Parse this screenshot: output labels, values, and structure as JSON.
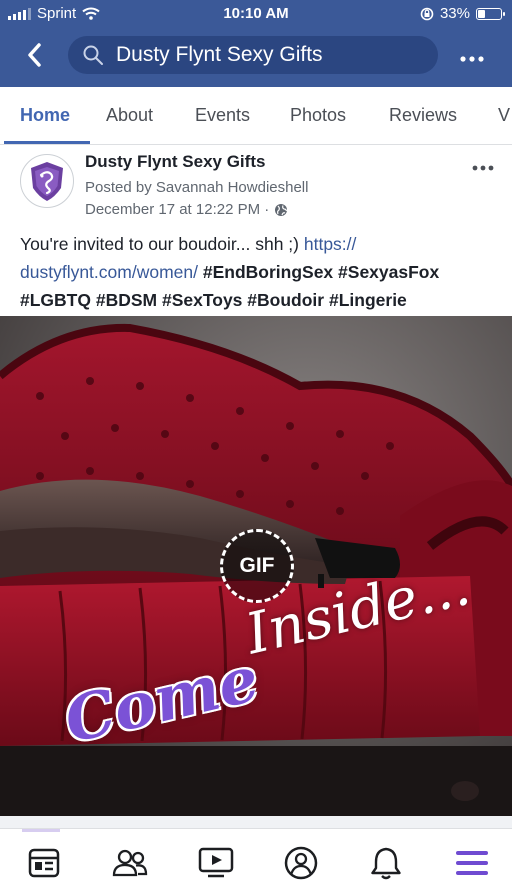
{
  "status_bar": {
    "carrier": "Sprint",
    "time": "10:10 AM",
    "battery": "33%",
    "battery_level": 0.33,
    "icons": [
      "signal-bars-icon",
      "wifi-icon",
      "screen-rotation-lock-icon",
      "battery-icon"
    ]
  },
  "header": {
    "search_text": "Dusty Flynt Sexy Gifts",
    "icons": [
      "back-chevron-icon",
      "search-icon",
      "more-dots-icon"
    ],
    "color": "#3b5998"
  },
  "tabs": [
    {
      "label": "Home",
      "active": true
    },
    {
      "label": "About",
      "active": false
    },
    {
      "label": "Events",
      "active": false
    },
    {
      "label": "Photos",
      "active": false
    },
    {
      "label": "Reviews",
      "active": false
    },
    {
      "label": "V",
      "active": false
    }
  ],
  "post": {
    "page_name": "Dusty Flynt Sexy Gifts",
    "posted_by": "Posted by Savannah Howdieshell",
    "date": "December 17 at 12:22 PM ·",
    "privacy_icon": "globe-icon",
    "text_intro": "You're invited to our boudoir... shh ;) ",
    "link": "https:// dustyflynt.com/women/",
    "hashtags": [
      "#EndBoringSex",
      "#SexyasFox",
      "#LGBTQ",
      "#BDSM",
      "#SexToys",
      "#Boudoir",
      "#Lingerie"
    ]
  },
  "media": {
    "badge": "GIF",
    "overlay_line1": "Inside...",
    "overlay_line2": "Come"
  },
  "bottom_nav": {
    "items": [
      "news-feed-icon",
      "friends-icon",
      "watch-video-icon",
      "profile-icon",
      "notifications-bell-icon",
      "menu-icon"
    ],
    "accent": "#6f4bd1"
  }
}
